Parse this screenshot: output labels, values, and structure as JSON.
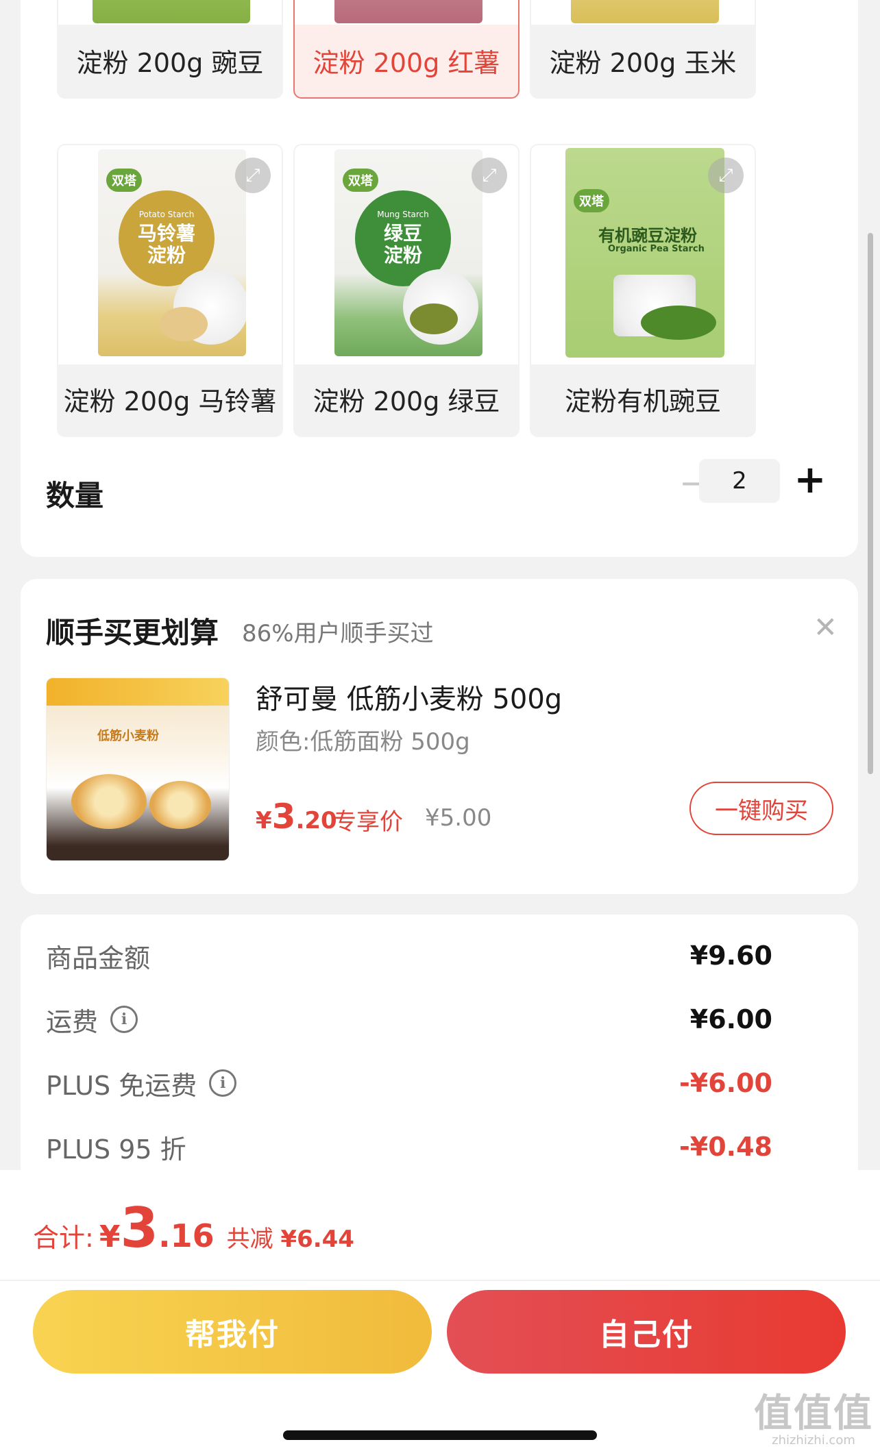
{
  "variants": [
    {
      "label": "淀粉 200g 豌豆",
      "selected": false
    },
    {
      "label": "淀粉 200g 红薯",
      "selected": true
    },
    {
      "label": "淀粉 200g 玉米",
      "selected": false
    },
    {
      "label": "淀粉 200g 马铃薯",
      "selected": false
    },
    {
      "label": "淀粉 200g 绿豆",
      "selected": false
    },
    {
      "label": "淀粉有机豌豆",
      "selected": false
    }
  ],
  "packages": {
    "potato": {
      "brand": "双塔",
      "en": "Potato Starch",
      "cn1": "马铃薯",
      "cn2": "淀粉"
    },
    "mung": {
      "brand": "双塔",
      "en": "Mung Starch",
      "cn1": "绿豆",
      "cn2": "淀粉"
    },
    "pea": {
      "brand": "双塔",
      "title": "有机豌豆淀粉",
      "en": "Organic Pea Starch"
    }
  },
  "quantity": {
    "label": "数量",
    "value": "2",
    "minus": "−",
    "plus": "+"
  },
  "addon": {
    "title": "顺手买更划算",
    "subtitle": "86%用户顺手买过",
    "name": "舒可曼 低筋小麦粉 500g",
    "spec": "颜色:低筋面粉 500g",
    "price_currency": "¥",
    "price_int": "3",
    "price_dec": ".20",
    "price_tag": "专享价",
    "original_price": "¥5.00",
    "buy_label": "一键购买",
    "img_text": "低筋小麦粉"
  },
  "summary": [
    {
      "label": "商品金额",
      "value": "¥9.60",
      "info": false,
      "negative": false
    },
    {
      "label": "运费",
      "value": "¥6.00",
      "info": true,
      "negative": false
    },
    {
      "label": "PLUS 免运费",
      "value": "-¥6.00",
      "info": true,
      "negative": true
    },
    {
      "label": "PLUS 95 折",
      "value": "-¥0.48",
      "info": false,
      "negative": true
    }
  ],
  "total": {
    "label": "合计:",
    "currency": "¥",
    "int": "3",
    "dec": ".16",
    "saved_label": "共减",
    "saved_value": "¥6.44"
  },
  "buttons": {
    "friend_pay": "帮我付",
    "self_pay": "自己付"
  },
  "watermark": {
    "big": "值值值",
    "small": "zhizhizhi.com"
  },
  "colors": {
    "accent": "#e2443a",
    "yellow": "#f4c542",
    "background": "#f2f2f2"
  }
}
